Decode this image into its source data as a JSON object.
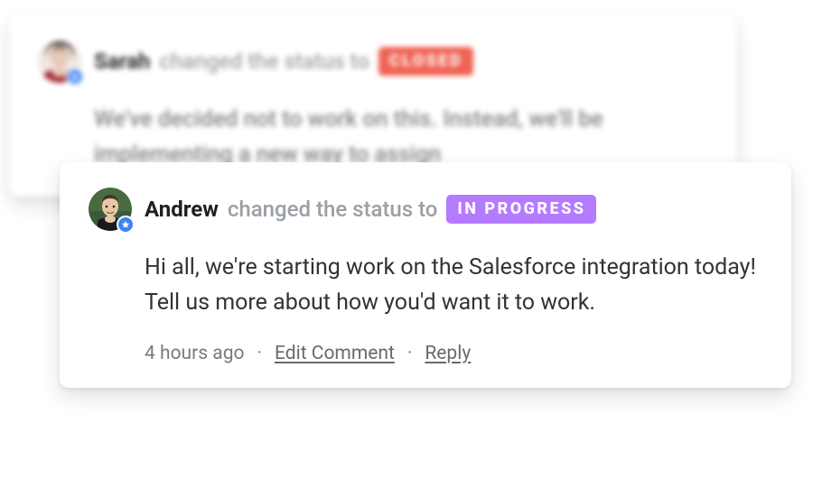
{
  "cards": {
    "back": {
      "author": "Sarah",
      "action_text": "changed the status to",
      "status_label": "CLOSED",
      "status_color": "#ef5b4c",
      "body": "We've decided not to work on this. Instead, we'll be implementing a new way to assign"
    },
    "front": {
      "author": "Andrew",
      "action_text": "changed the status to",
      "status_label": "IN PROGRESS",
      "status_color": "#b57bff",
      "body": "Hi all, we're starting work on the Salesforce integration today! Tell us more about how you'd want it to work.",
      "meta": {
        "timestamp": "4 hours ago",
        "edit_label": "Edit Comment",
        "reply_label": "Reply"
      }
    }
  },
  "icons": {
    "admin_badge": "star-icon"
  }
}
